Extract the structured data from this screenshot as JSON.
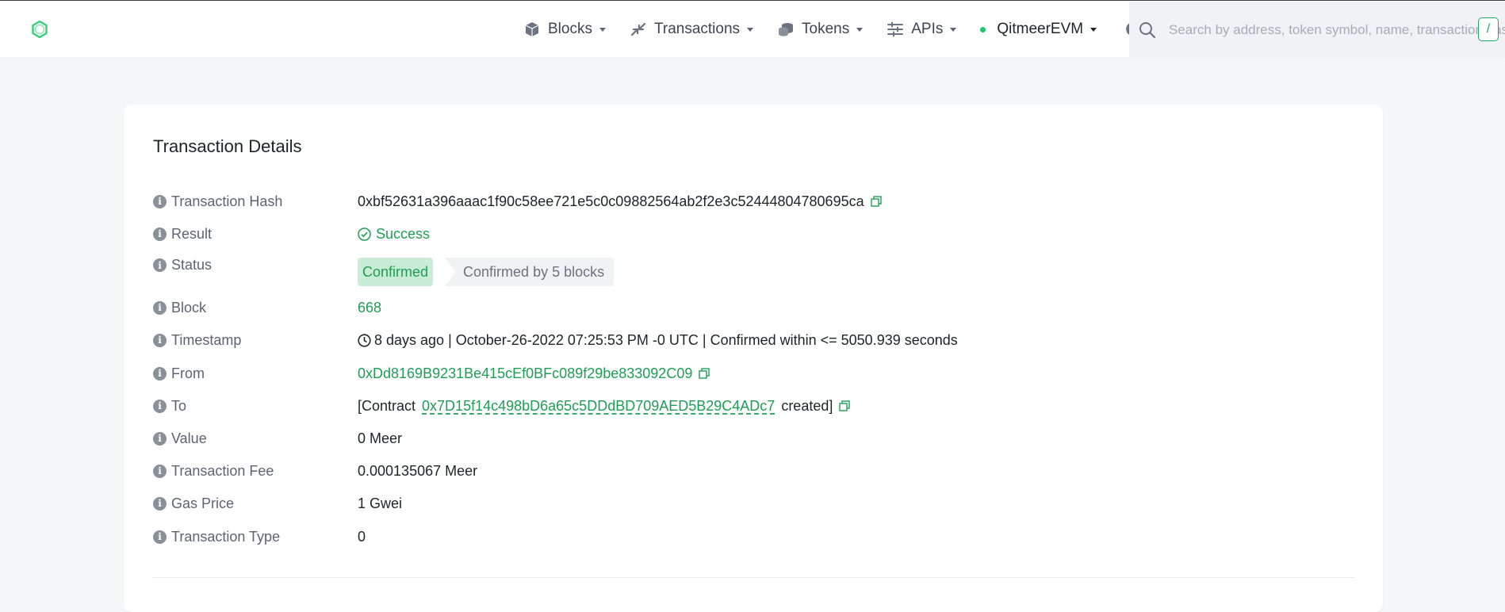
{
  "header": {
    "nav": [
      {
        "label": "Blocks",
        "icon": "cube-icon"
      },
      {
        "label": "Transactions",
        "icon": "arrows-icon"
      },
      {
        "label": "Tokens",
        "icon": "coins-icon"
      },
      {
        "label": "APIs",
        "icon": "sliders-icon"
      }
    ],
    "network": "QitmeerEVM",
    "search_placeholder": "Search by address, token symbol, name, transaction hash, or block number",
    "search_shortcut": "/"
  },
  "card": {
    "title": "Transaction Details",
    "rows": {
      "hash": {
        "label": "Transaction Hash",
        "value": "0xbf52631a396aaac1f90c58ee721e5c0c09882564ab2f2e3c52444804780695ca"
      },
      "result": {
        "label": "Result",
        "value": "Success"
      },
      "status": {
        "label": "Status",
        "badge": "Confirmed",
        "confirmations": "Confirmed by 5 blocks"
      },
      "block": {
        "label": "Block",
        "value": "668"
      },
      "timestamp": {
        "label": "Timestamp",
        "value": "8 days ago | October-26-2022 07:25:53 PM -0 UTC | Confirmed within <= 5050.939 seconds"
      },
      "from": {
        "label": "From",
        "value": "0xDd8169B9231Be415cEf0BFc089f29be833092C09"
      },
      "to": {
        "label": "To",
        "prefix": "[Contract",
        "value": "0x7D15f14c498bD6a65c5DDdBD709AED5B29C4ADc7",
        "suffix": "created]"
      },
      "value": {
        "label": "Value",
        "value": "0 Meer"
      },
      "fee": {
        "label": "Transaction Fee",
        "value": "0.000135067 Meer"
      },
      "gas_price": {
        "label": "Gas Price",
        "value": "1 Gwei"
      },
      "tx_type": {
        "label": "Transaction Type",
        "value": "0"
      }
    }
  },
  "colors": {
    "accent": "#1e9e55",
    "badge_bg": "#c9ecd6",
    "page_bg": "#f6f7f9"
  }
}
